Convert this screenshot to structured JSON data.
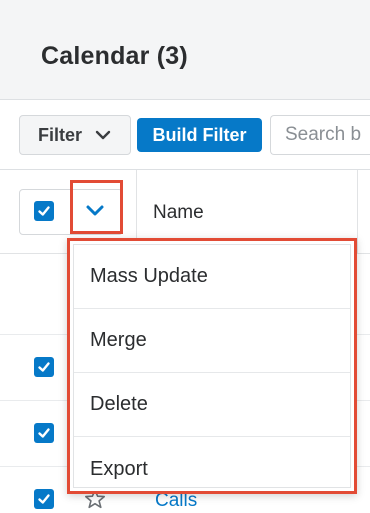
{
  "header": {
    "title": "Calendar (3)"
  },
  "toolbar": {
    "filter_label": "Filter",
    "build_filter_label": "Build Filter",
    "search_placeholder": "Search b"
  },
  "table": {
    "name_column": "Name",
    "visible_link": "Calls"
  },
  "mass_actions": {
    "items": [
      "Mass Update",
      "Merge",
      "Delete",
      "Export"
    ]
  },
  "colors": {
    "accent": "#0679c8",
    "highlight": "#e24b35"
  }
}
